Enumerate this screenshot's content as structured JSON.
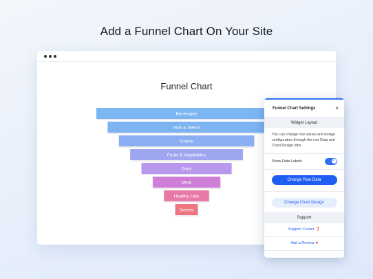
{
  "headline": "Add a Funnel Chart On Your Site",
  "chart_data": {
    "type": "funnel",
    "title": "Funnel Chart",
    "categories": [
      "Beverages",
      "Nuts & Seeds",
      "Grains",
      "Fruits & Vegetables",
      "Dairy",
      "Meat",
      "Healthy Fats",
      "Sweets"
    ],
    "values": [
      8,
      7,
      6,
      5,
      4,
      3,
      2,
      1
    ],
    "colors": [
      "#7cb6f2",
      "#7db3f1",
      "#8aaff2",
      "#9ea6ef",
      "#b897ee",
      "#d07fd8",
      "#e879a6",
      "#ee7480"
    ]
  },
  "panel": {
    "title": "Funnel Chart Settings",
    "close": "×",
    "widget_layout": "Widget Layout",
    "description": "You can change row values and design configuration through the row Data and Chart Design tabs.",
    "show_data_labels": "Show Data Labels",
    "toggle_check": "✓",
    "change_row_data": "Change Row Data",
    "change_chart_design": "Change Chart Design",
    "support": "Support",
    "support_center": "Support Center",
    "support_icon": "❓",
    "add_review": "Add a Review",
    "review_icon": "♥"
  }
}
